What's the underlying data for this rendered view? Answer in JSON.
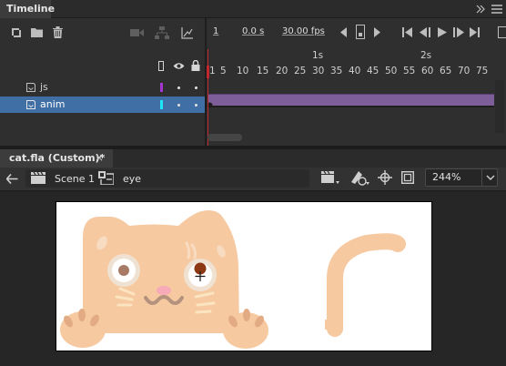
{
  "timeline": {
    "tab_title": "Timeline",
    "current_frame": "1",
    "elapsed_time": "0.0 s",
    "frame_rate": "30.00 fps",
    "ruler_seconds": [
      "1s",
      "2s"
    ],
    "ruler_frames": [
      "1",
      "5",
      "10",
      "15",
      "20",
      "25",
      "30",
      "35",
      "40",
      "45",
      "50",
      "55",
      "60",
      "65",
      "70",
      "75"
    ],
    "layers": [
      {
        "name": "js",
        "color": "#a335d1",
        "selected": false
      },
      {
        "name": "anim",
        "color": "#1ee6f5",
        "selected": true
      }
    ]
  },
  "document": {
    "tab_title": "cat.fla (Custom)*",
    "close_glyph": "×",
    "breadcrumb": [
      "Scene 1",
      "eye"
    ],
    "zoom": "244%"
  },
  "colors": {
    "cat_body": "#f6c9a1",
    "cat_ear_inner": "#f8dcc2",
    "cat_nose": "#f7aab8",
    "cat_mouth": "#b4927d",
    "cat_eye_ring": "#f0e2d2",
    "cat_pupil_left": "#a77b66",
    "cat_pupil_right": "#8b3813",
    "cat_whisker": "#fbe5c0",
    "cat_paw_toe": "#e3ab84",
    "selected_layer_bg": "#3f6fa5",
    "playhead": "#c0282d"
  }
}
